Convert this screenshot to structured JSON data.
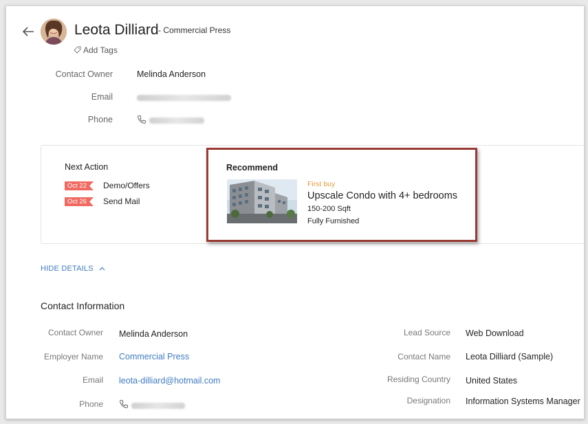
{
  "header": {
    "name": "Leota Dilliard",
    "company": "- Commercial Press",
    "add_tags": "Add Tags"
  },
  "summary": {
    "owner_label": "Contact Owner",
    "owner_value": "Melinda Anderson",
    "email_label": "Email",
    "phone_label": "Phone"
  },
  "next_action": {
    "title": "Next Action",
    "items": [
      {
        "date": "Oct 22",
        "label": "Demo/Offers"
      },
      {
        "date": "Oct 26",
        "label": "Send Mail"
      }
    ]
  },
  "recommend": {
    "title": "Recommend",
    "tag": "First buy",
    "headline": "Upscale Condo with 4+ bedrooms",
    "size": "150-200 Sqft",
    "furnishing": "Fully Furnished"
  },
  "details_toggle": "HIDE DETAILS",
  "contact_info": {
    "title": "Contact Information",
    "left": [
      {
        "label": "Contact Owner",
        "value": "Melinda Anderson"
      },
      {
        "label": "Employer Name",
        "value": "Commercial Press"
      },
      {
        "label": "Email",
        "value": "leota-dilliard@hotmail.com"
      },
      {
        "label": "Phone",
        "value": ""
      }
    ],
    "right": [
      {
        "label": "Lead Source",
        "value": "Web Download"
      },
      {
        "label": "Contact Name",
        "value": "Leota Dilliard (Sample)"
      },
      {
        "label": "Residing Country",
        "value": "United States"
      },
      {
        "label": "Designation",
        "value": "Information Systems Manager"
      }
    ]
  },
  "colors": {
    "accent_link": "#3f7bc0",
    "date_badge": "#f06a62",
    "recommend_border": "#9a3a34",
    "first_buy": "#e49b3b"
  }
}
